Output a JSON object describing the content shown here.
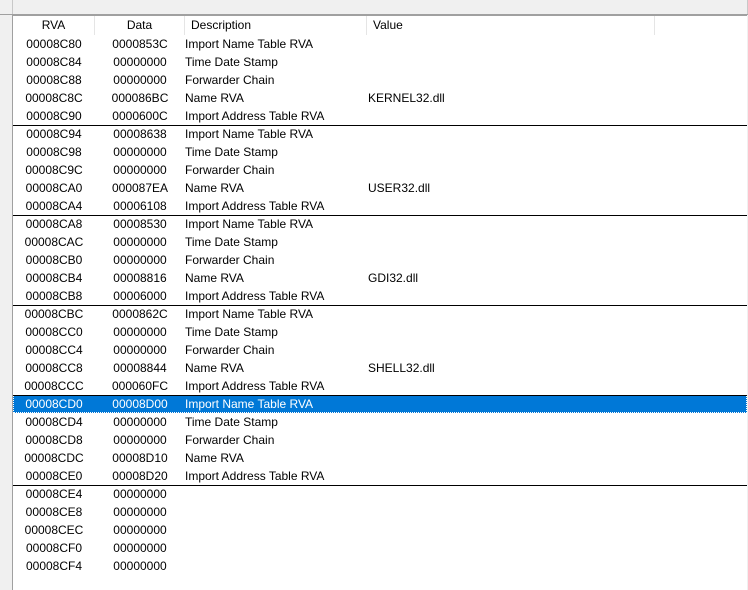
{
  "columns": {
    "rva": "RVA",
    "data": "Data",
    "description": "Description",
    "value": "Value"
  },
  "rows": [
    {
      "rva": "00008C80",
      "data": "0000853C",
      "desc": "Import Name Table RVA",
      "value": ""
    },
    {
      "rva": "00008C84",
      "data": "00000000",
      "desc": "Time Date Stamp",
      "value": ""
    },
    {
      "rva": "00008C88",
      "data": "00000000",
      "desc": "Forwarder Chain",
      "value": ""
    },
    {
      "rva": "00008C8C",
      "data": "000086BC",
      "desc": "Name RVA",
      "value": "KERNEL32.dll"
    },
    {
      "rva": "00008C90",
      "data": "0000600C",
      "desc": "Import Address Table RVA",
      "value": ""
    },
    {
      "rva": "00008C94",
      "data": "00008638",
      "desc": "Import Name Table RVA",
      "value": ""
    },
    {
      "rva": "00008C98",
      "data": "00000000",
      "desc": "Time Date Stamp",
      "value": ""
    },
    {
      "rva": "00008C9C",
      "data": "00000000",
      "desc": "Forwarder Chain",
      "value": ""
    },
    {
      "rva": "00008CA0",
      "data": "000087EA",
      "desc": "Name RVA",
      "value": "USER32.dll"
    },
    {
      "rva": "00008CA4",
      "data": "00006108",
      "desc": "Import Address Table RVA",
      "value": ""
    },
    {
      "rva": "00008CA8",
      "data": "00008530",
      "desc": "Import Name Table RVA",
      "value": ""
    },
    {
      "rva": "00008CAC",
      "data": "00000000",
      "desc": "Time Date Stamp",
      "value": ""
    },
    {
      "rva": "00008CB0",
      "data": "00000000",
      "desc": "Forwarder Chain",
      "value": ""
    },
    {
      "rva": "00008CB4",
      "data": "00008816",
      "desc": "Name RVA",
      "value": "GDI32.dll"
    },
    {
      "rva": "00008CB8",
      "data": "00006000",
      "desc": "Import Address Table RVA",
      "value": ""
    },
    {
      "rva": "00008CBC",
      "data": "0000862C",
      "desc": "Import Name Table RVA",
      "value": ""
    },
    {
      "rva": "00008CC0",
      "data": "00000000",
      "desc": "Time Date Stamp",
      "value": ""
    },
    {
      "rva": "00008CC4",
      "data": "00000000",
      "desc": "Forwarder Chain",
      "value": ""
    },
    {
      "rva": "00008CC8",
      "data": "00008844",
      "desc": "Name RVA",
      "value": "SHELL32.dll"
    },
    {
      "rva": "00008CCC",
      "data": "000060FC",
      "desc": "Import Address Table RVA",
      "value": ""
    },
    {
      "rva": "00008CD0",
      "data": "00008D00",
      "desc": "Import Name Table RVA",
      "value": "",
      "selected": true
    },
    {
      "rva": "00008CD4",
      "data": "00000000",
      "desc": "Time Date Stamp",
      "value": ""
    },
    {
      "rva": "00008CD8",
      "data": "00000000",
      "desc": "Forwarder Chain",
      "value": ""
    },
    {
      "rva": "00008CDC",
      "data": "00008D10",
      "desc": "Name RVA",
      "value": ""
    },
    {
      "rva": "00008CE0",
      "data": "00008D20",
      "desc": "Import Address Table RVA",
      "value": ""
    },
    {
      "rva": "00008CE4",
      "data": "00000000",
      "desc": "",
      "value": ""
    },
    {
      "rva": "00008CE8",
      "data": "00000000",
      "desc": "",
      "value": ""
    },
    {
      "rva": "00008CEC",
      "data": "00000000",
      "desc": "",
      "value": ""
    },
    {
      "rva": "00008CF0",
      "data": "00000000",
      "desc": "",
      "value": ""
    },
    {
      "rva": "00008CF4",
      "data": "00000000",
      "desc": "",
      "value": ""
    }
  ],
  "colors": {
    "selection": "#0078d7",
    "separator": "#000000"
  }
}
